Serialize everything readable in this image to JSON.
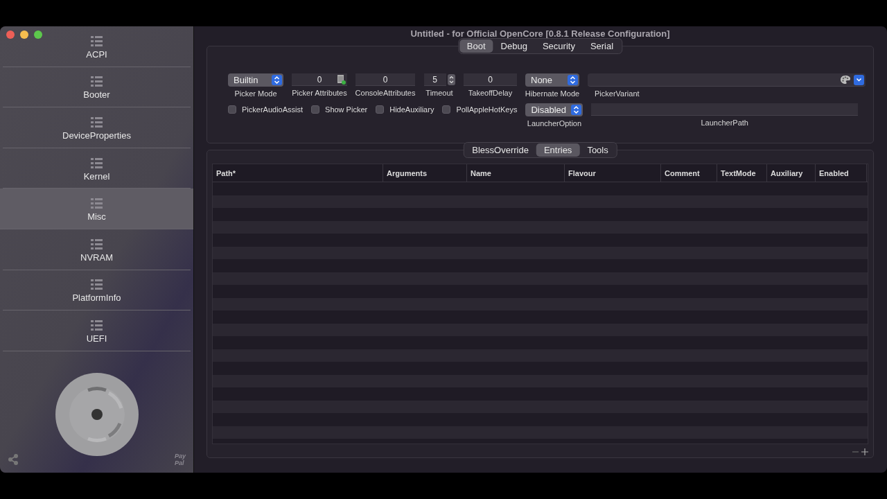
{
  "window": {
    "title": "Untitled - for Official OpenCore [0.8.1 Release Configuration]"
  },
  "sidebar": {
    "items": [
      {
        "label": "ACPI",
        "selected": false
      },
      {
        "label": "Booter",
        "selected": false
      },
      {
        "label": "DeviceProperties",
        "selected": false
      },
      {
        "label": "Kernel",
        "selected": false
      },
      {
        "label": "Misc",
        "selected": true
      },
      {
        "label": "NVRAM",
        "selected": false
      },
      {
        "label": "PlatformInfo",
        "selected": false
      },
      {
        "label": "UEFI",
        "selected": false
      }
    ],
    "paypal": [
      "Pay",
      "Pal"
    ]
  },
  "top_tabs": [
    {
      "label": "Boot",
      "selected": true
    },
    {
      "label": "Debug",
      "selected": false
    },
    {
      "label": "Security",
      "selected": false
    },
    {
      "label": "Serial",
      "selected": false
    }
  ],
  "boot": {
    "fields": [
      {
        "kind": "popup",
        "value": "Builtin",
        "label": "Picker Mode"
      },
      {
        "kind": "number_icon",
        "value": "0",
        "label": "Picker Attributes"
      },
      {
        "kind": "number",
        "value": "0",
        "label": "ConsoleAttributes"
      },
      {
        "kind": "stepper",
        "value": "5",
        "label": "Timeout"
      },
      {
        "kind": "number",
        "value": "0",
        "label": "TakeoffDelay"
      },
      {
        "kind": "popup",
        "value": "None",
        "label": "Hibernate Mode"
      },
      {
        "kind": "combo",
        "label": "PickerVariant"
      }
    ],
    "checkboxes": [
      {
        "label": "PickerAudioAssist",
        "checked": false
      },
      {
        "label": "Show Picker",
        "checked": false
      },
      {
        "label": "HideAuxiliary",
        "checked": false
      },
      {
        "label": "PollAppleHotKeys",
        "checked": false
      }
    ],
    "launcher_option": {
      "value": "Disabled",
      "label": "LauncherOption"
    },
    "launcher_path": {
      "label": "LauncherPath"
    }
  },
  "sub_tabs": [
    {
      "label": "BlessOverride",
      "selected": false
    },
    {
      "label": "Entries",
      "selected": true
    },
    {
      "label": "Tools",
      "selected": false
    }
  ],
  "table": {
    "columns": [
      "Path*",
      "Arguments",
      "Name",
      "Flavour",
      "Comment",
      "TextMode",
      "Auxiliary",
      "Enabled"
    ]
  }
}
